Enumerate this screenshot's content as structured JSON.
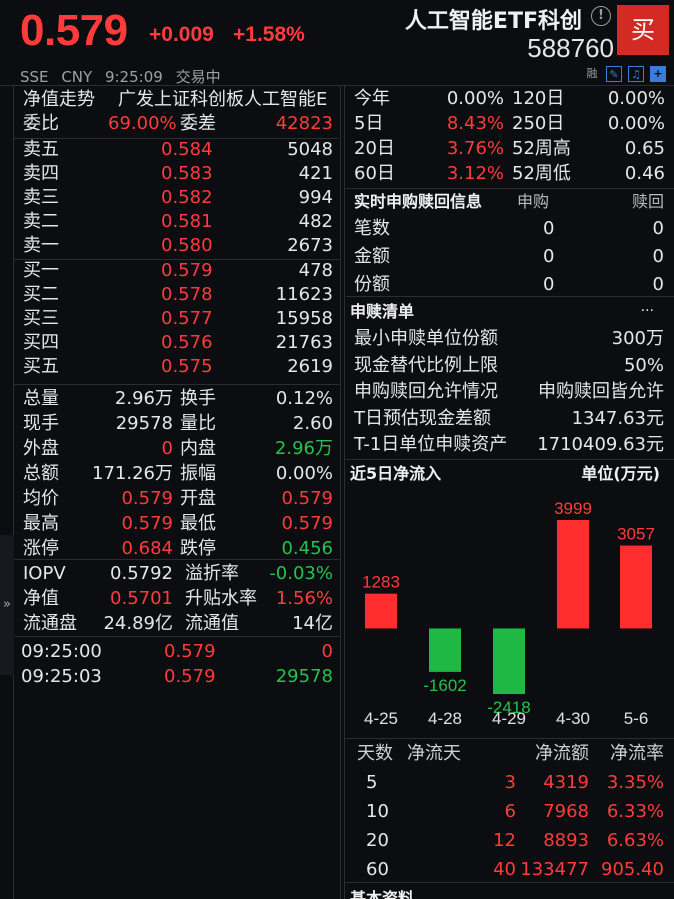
{
  "header": {
    "price": "0.579",
    "change": "+0.009",
    "change_pct": "+1.58%",
    "name": "人工智能ETF科创",
    "code": "588760",
    "buy_label": "买",
    "info_icon": "!",
    "exchange": "SSE",
    "currency": "CNY",
    "time": "9:25:09",
    "status": "交易中",
    "mini_icons": [
      "融",
      "pencil-icon",
      "bell-icon",
      "plus-icon"
    ],
    "colors": {
      "up": "#ff3b3b",
      "down": "#27c24c",
      "buy_button": "#d42a24",
      "accent": "#3a7dd8"
    }
  },
  "left": {
    "nav_title": "净值走势",
    "fund_full_name": "广发上证科创板人工智能E",
    "weibi": {
      "label": "委比",
      "value": "69.00%",
      "diff_label": "委差",
      "diff_value": "42823"
    },
    "asks": [
      {
        "label": "卖五",
        "price": "0.584",
        "vol": "5048"
      },
      {
        "label": "卖四",
        "price": "0.583",
        "vol": "421"
      },
      {
        "label": "卖三",
        "price": "0.582",
        "vol": "994"
      },
      {
        "label": "卖二",
        "price": "0.581",
        "vol": "482"
      },
      {
        "label": "卖一",
        "price": "0.580",
        "vol": "2673"
      }
    ],
    "bids": [
      {
        "label": "买一",
        "price": "0.579",
        "vol": "478"
      },
      {
        "label": "买二",
        "price": "0.578",
        "vol": "11623"
      },
      {
        "label": "买三",
        "price": "0.577",
        "vol": "15958"
      },
      {
        "label": "买四",
        "price": "0.576",
        "vol": "21763"
      },
      {
        "label": "买五",
        "price": "0.575",
        "vol": "2619"
      }
    ],
    "stats": [
      {
        "l1": "总量",
        "v1": "2.96万",
        "c1": "white",
        "l2": "换手",
        "v2": "0.12%",
        "c2": "white"
      },
      {
        "l1": "现手",
        "v1": "29578",
        "c1": "white",
        "l2": "量比",
        "v2": "2.60",
        "c2": "white"
      },
      {
        "l1": "外盘",
        "v1": "0",
        "c1": "red",
        "l2": "内盘",
        "v2": "2.96万",
        "c2": "green"
      },
      {
        "l1": "总额",
        "v1": "171.26万",
        "c1": "white",
        "l2": "振幅",
        "v2": "0.00%",
        "c2": "white"
      },
      {
        "l1": "均价",
        "v1": "0.579",
        "c1": "red",
        "l2": "开盘",
        "v2": "0.579",
        "c2": "red"
      },
      {
        "l1": "最高",
        "v1": "0.579",
        "c1": "red",
        "l2": "最低",
        "v2": "0.579",
        "c2": "red"
      },
      {
        "l1": "涨停",
        "v1": "0.684",
        "c1": "red",
        "l2": "跌停",
        "v2": "0.456",
        "c2": "green"
      }
    ],
    "nav_stats": [
      {
        "l1": "IOPV",
        "v1": "0.5792",
        "c1": "white",
        "l2": "溢折率",
        "v2": "-0.03%",
        "c2": "green"
      },
      {
        "l1": "净值",
        "v1": "0.5701",
        "c1": "red",
        "l2": "升贴水率",
        "v2": "1.56%",
        "c2": "red"
      },
      {
        "l1": "流通盘",
        "v1": "24.89亿",
        "c1": "white",
        "l2": "流通值",
        "v2": "14亿",
        "c2": "white"
      }
    ],
    "ticks": [
      {
        "time": "09:25:00",
        "price": "0.579",
        "vol": "0",
        "vol_color": "red"
      },
      {
        "time": "09:25:03",
        "price": "0.579",
        "vol": "29578",
        "vol_color": "green"
      }
    ],
    "expander_icon": "»"
  },
  "right": {
    "perf": [
      {
        "l1": "今年",
        "v1": "0.00%",
        "c1": "white",
        "l2": "120日",
        "v2": "0.00%"
      },
      {
        "l1": "5日",
        "v1": "8.43%",
        "c1": "red",
        "l2": "250日",
        "v2": "0.00%"
      },
      {
        "l1": "20日",
        "v1": "3.76%",
        "c1": "red",
        "l2": "52周高",
        "v2": "0.65"
      },
      {
        "l1": "60日",
        "v1": "3.12%",
        "c1": "red",
        "l2": "52周低",
        "v2": "0.46"
      }
    ],
    "sub_redeem": {
      "title": "实时申购赎回信息",
      "col_sub": "申购",
      "col_red": "赎回",
      "rows": [
        {
          "label": "笔数",
          "sub": "0",
          "red": "0"
        },
        {
          "label": "金额",
          "sub": "0",
          "red": "0"
        },
        {
          "label": "份额",
          "sub": "0",
          "red": "0"
        }
      ]
    },
    "list": {
      "title": "申赎清单",
      "more": "···",
      "rows": [
        {
          "label": "最小申赎单位份额",
          "value": "300万"
        },
        {
          "label": "现金替代比例上限",
          "value": "50%"
        },
        {
          "label": "申购赎回允许情况",
          "value": "申购赎回皆允许"
        },
        {
          "label": "T日预估现金差额",
          "value": "1347.63元"
        },
        {
          "label": "T-1日单位申赎资产",
          "value": "1710409.63元"
        }
      ]
    },
    "flow": {
      "title": "近5日净流入",
      "unit": "单位(万元)",
      "table_headers": [
        "天数",
        "净流天",
        "净流额",
        "净流率"
      ],
      "table_rows": [
        {
          "days": "5",
          "flow_days": "3",
          "amount": "4319",
          "rate": "3.35%"
        },
        {
          "days": "10",
          "flow_days": "6",
          "amount": "7968",
          "rate": "6.33%"
        },
        {
          "days": "20",
          "flow_days": "12",
          "amount": "8893",
          "rate": "6.63%"
        },
        {
          "days": "60",
          "flow_days": "40",
          "amount": "133477",
          "rate": "905.40"
        }
      ]
    },
    "basic_info_title": "基本资料"
  },
  "chart_data": {
    "type": "bar",
    "categories": [
      "4-25",
      "4-28",
      "4-29",
      "4-30",
      "5-6"
    ],
    "values": [
      1283,
      -1602,
      -2418,
      3999,
      3057
    ],
    "title": "近5日净流入",
    "xlabel": "",
    "ylabel": "单位(万元)",
    "ylim": [
      -2418,
      3999
    ],
    "grid": false,
    "colors": {
      "positive": "#ff2d2d",
      "negative": "#1fb845"
    }
  }
}
